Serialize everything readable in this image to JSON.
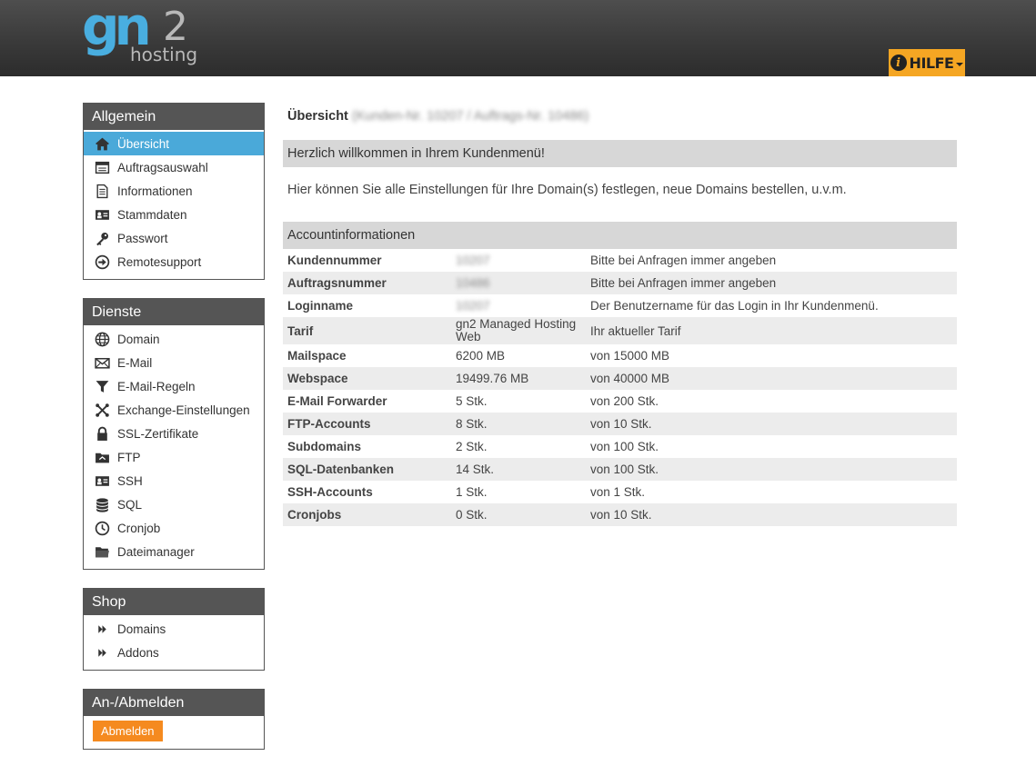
{
  "header": {
    "logo": {
      "brand": "gn",
      "number": "2",
      "sub": "hosting"
    },
    "help_label": "HILFE"
  },
  "sidebar": {
    "general": {
      "title": "Allgemein",
      "items": [
        {
          "label": "Übersicht",
          "icon": "home-icon",
          "active": true
        },
        {
          "label": "Auftragsauswahl",
          "icon": "window-icon"
        },
        {
          "label": "Informationen",
          "icon": "document-icon"
        },
        {
          "label": "Stammdaten",
          "icon": "id-card-icon"
        },
        {
          "label": "Passwort",
          "icon": "key-icon"
        },
        {
          "label": "Remotesupport",
          "icon": "arrow-circle-icon"
        }
      ]
    },
    "services": {
      "title": "Dienste",
      "items": [
        {
          "label": "Domain",
          "icon": "globe-icon"
        },
        {
          "label": "E-Mail",
          "icon": "envelope-icon"
        },
        {
          "label": "E-Mail-Regeln",
          "icon": "filter-icon"
        },
        {
          "label": "Exchange-Einstellungen",
          "icon": "exchange-icon"
        },
        {
          "label": "SSL-Zertifikate",
          "icon": "lock-icon"
        },
        {
          "label": "FTP",
          "icon": "folder-link-icon"
        },
        {
          "label": "SSH",
          "icon": "id-card-icon"
        },
        {
          "label": "SQL",
          "icon": "database-icon"
        },
        {
          "label": "Cronjob",
          "icon": "clock-icon"
        },
        {
          "label": "Dateimanager",
          "icon": "folder-icon"
        }
      ]
    },
    "shop": {
      "title": "Shop",
      "items": [
        {
          "label": "Domains",
          "icon": "double-chevron-icon"
        },
        {
          "label": "Addons",
          "icon": "double-chevron-icon"
        }
      ]
    },
    "auth": {
      "title": "An-/Abmelden",
      "logout_label": "Abmelden"
    }
  },
  "main": {
    "title": "Übersicht",
    "title_suffix_redacted": "(Kunden-Nr. 10207 / Auftrags-Nr. 10486)",
    "welcome_heading": "Herzlich willkommen in Ihrem Kundenmenü!",
    "welcome_text": "Hier können Sie alle Einstellungen für Ihre Domain(s) festlegen, neue Domains bestellen, u.v.m.",
    "account_heading": "Accountinformationen",
    "rows": [
      {
        "key": "Kundennummer",
        "value": "10207",
        "note": "Bitte bei Anfragen immer angeben",
        "redacted": true
      },
      {
        "key": "Auftragsnummer",
        "value": "10486",
        "note": "Bitte bei Anfragen immer angeben",
        "redacted": true
      },
      {
        "key": "Loginname",
        "value": "10207",
        "note": "Der Benutzername für das Login in Ihr Kundenmenü.",
        "redacted": true
      },
      {
        "key": "Tarif",
        "value": "gn2 Managed Hosting Web",
        "note": "Ihr aktueller Tarif"
      },
      {
        "key": "Mailspace",
        "value": "6200 MB",
        "note": "von 15000 MB"
      },
      {
        "key": "Webspace",
        "value": "19499.76 MB",
        "note": "von 40000 MB"
      },
      {
        "key": "E-Mail Forwarder",
        "value": "5 Stk.",
        "note": "von 200 Stk."
      },
      {
        "key": "FTP-Accounts",
        "value": "8 Stk.",
        "note": "von 10 Stk."
      },
      {
        "key": "Subdomains",
        "value": "2 Stk.",
        "note": "von 100 Stk."
      },
      {
        "key": "SQL-Datenbanken",
        "value": "14 Stk.",
        "note": "von 100 Stk."
      },
      {
        "key": "SSH-Accounts",
        "value": "1 Stk.",
        "note": "von 1 Stk."
      },
      {
        "key": "Cronjobs",
        "value": "0 Stk.",
        "note": "von 10 Stk."
      }
    ]
  },
  "colors": {
    "accent": "#4aa9d9",
    "help": "#f5a623",
    "logout": "#f58a1f",
    "sidebar_header": "#555555"
  }
}
